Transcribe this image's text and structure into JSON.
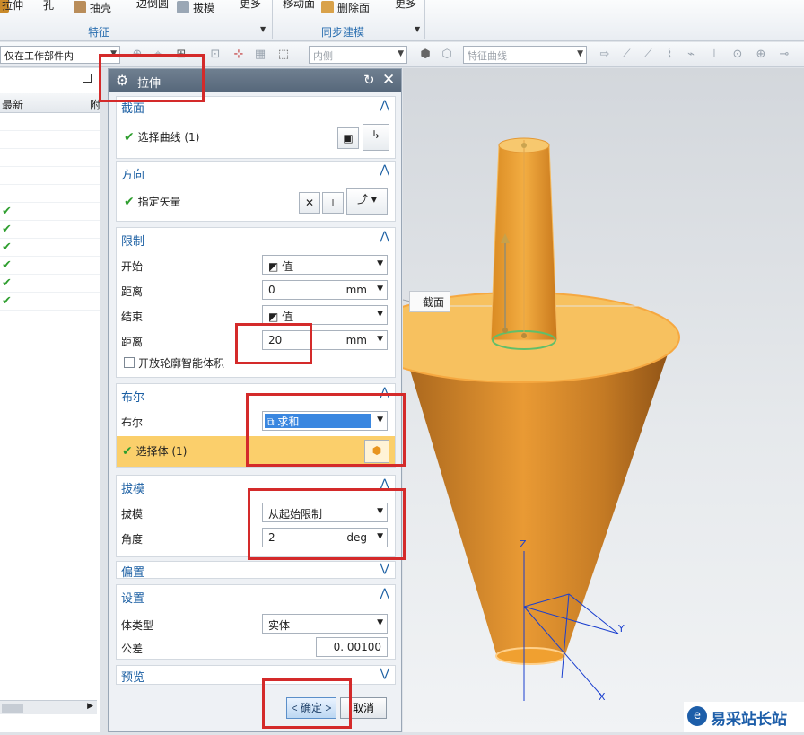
{
  "ribbon": {
    "tools": [
      {
        "label": "拉伸",
        "icon": "extrude-icon"
      },
      {
        "label": "孔",
        "icon": "hole-icon"
      },
      {
        "label": "抽壳",
        "icon": "shell-icon"
      },
      {
        "label": "边倒圆",
        "icon": "edge-blend-icon"
      },
      {
        "label": "拔模",
        "icon": "draft-icon"
      },
      {
        "label": "更多",
        "icon": "more-icon"
      },
      {
        "label": "移动面",
        "icon": "move-face-icon"
      },
      {
        "label": "删除面",
        "icon": "delete-face-icon"
      },
      {
        "label": "更多",
        "icon": "more-icon"
      }
    ],
    "groups": [
      "特征",
      "同步建模"
    ]
  },
  "selection_bar": {
    "scope_filter": "仅在工作部件内",
    "rule_combo": "内侧",
    "curve_rule": "特征曲线"
  },
  "navigator": {
    "column_header": "最新",
    "column_header_2": "附",
    "checked_rows": 6
  },
  "dialog": {
    "title": "拉伸",
    "sections": {
      "section": {
        "title": "截面",
        "select_curve": "选择曲线 (1)"
      },
      "direction": {
        "title": "方向",
        "specify_vector": "指定矢量"
      },
      "limits": {
        "title": "限制",
        "start_label": "开始",
        "start_value": "值",
        "start_distance_label": "距离",
        "start_distance": "0",
        "start_unit": "mm",
        "end_label": "结束",
        "end_value": "值",
        "end_distance_label": "距离",
        "end_distance": "20",
        "end_unit": "mm",
        "open_profile": "开放轮廓智能体积"
      },
      "boolean": {
        "title": "布尔",
        "boolean_label": "布尔",
        "boolean_value": "求和",
        "select_body": "选择体 (1)"
      },
      "draft": {
        "title": "拔模",
        "draft_label": "拔模",
        "draft_value": "从起始限制",
        "angle_label": "角度",
        "angle_value": "2",
        "angle_unit": "deg"
      },
      "offset": {
        "title": "偏置"
      },
      "settings": {
        "title": "设置",
        "body_type_label": "体类型",
        "body_type_value": "实体",
        "tolerance_label": "公差",
        "tolerance_value": "0. 00100"
      },
      "preview": {
        "title": "预览"
      }
    },
    "ok_button": "< 确定 >",
    "cancel_button": "取消"
  },
  "viewport": {
    "section_tag": "截面",
    "axes": {
      "x": "X",
      "y": "Y",
      "z": "Z"
    }
  },
  "watermark": "易采站长站",
  "colors": {
    "accent": "#1b5fa3",
    "body_orange": "#f0a030",
    "highlight": "#fbcf6b",
    "annotation_red": "#d42a2a",
    "axis_blue": "#1a3fcf"
  }
}
